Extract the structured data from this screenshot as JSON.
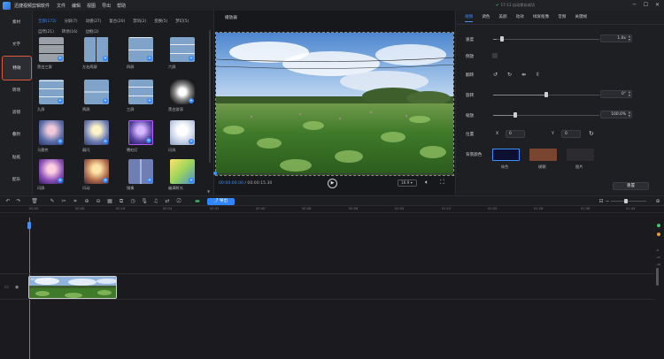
{
  "app": {
    "title": "迅捷视频剪辑软件"
  },
  "menu": [
    "文件",
    "编辑",
    "视图",
    "导出",
    "帮助"
  ],
  "save_status": "17:13 自动保存成功",
  "window_controls": [
    "minimize-icon",
    "maximize-icon",
    "close-icon"
  ],
  "left_rail": {
    "items": [
      {
        "label": "素材",
        "active": false
      },
      {
        "label": "文字",
        "active": false
      },
      {
        "label": "特效",
        "active": true
      },
      {
        "label": "转场",
        "active": false
      },
      {
        "label": "滤镜",
        "active": false
      },
      {
        "label": "叠附",
        "active": false
      },
      {
        "label": "贴纸",
        "active": false
      },
      {
        "label": "配乐",
        "active": false
      }
    ]
  },
  "effects": {
    "tabs": [
      {
        "label": "全部(172)",
        "active": true
      },
      {
        "label": "分屏(7)",
        "active": false
      },
      {
        "label": "动感(27)",
        "active": false
      },
      {
        "label": "复古(20)",
        "active": false
      },
      {
        "label": "禁风(2)",
        "active": false
      },
      {
        "label": "变换(5)",
        "active": false
      },
      {
        "label": "梦幻(5)",
        "active": false
      },
      {
        "label": "自然(21)",
        "active": false
      },
      {
        "label": "转场(16)",
        "active": false
      },
      {
        "label": "边框(2)",
        "active": false
      }
    ],
    "items": [
      {
        "label": "黑白三屏"
      },
      {
        "label": "左右两屏"
      },
      {
        "label": "四屏"
      },
      {
        "label": "六屏"
      },
      {
        "label": "九屏"
      },
      {
        "label": "两屏"
      },
      {
        "label": "三屏"
      },
      {
        "label": "黑白漩涡"
      },
      {
        "label": "马赛克"
      },
      {
        "label": "弱闪"
      },
      {
        "label": "霓虹灯"
      },
      {
        "label": "闪烁"
      },
      {
        "label": "闪屏"
      },
      {
        "label": "闪动"
      },
      {
        "label": "镜像"
      },
      {
        "label": "幽满射光"
      }
    ]
  },
  "player": {
    "title": "播放器",
    "current_time": "00:00:00.00",
    "total_time": "00:00:15.30",
    "aspect_ratio": "16:9",
    "progress": 0
  },
  "properties": {
    "tabs": [
      {
        "label": "视频",
        "active": true
      },
      {
        "label": "调色",
        "active": false
      },
      {
        "label": "美颜",
        "active": false
      },
      {
        "label": "动效",
        "active": false
      },
      {
        "label": "绿屏抠像",
        "active": false
      },
      {
        "label": "音频",
        "active": false
      },
      {
        "label": "关键帧",
        "active": false
      }
    ],
    "speed": {
      "label": "速度",
      "value": "1.0x",
      "level": 0.03
    },
    "reverse": {
      "label": "倒放"
    },
    "flip": {
      "label": "翻转"
    },
    "rotate": {
      "label": "旋转",
      "value": "0°",
      "level": 0.5
    },
    "scale": {
      "label": "缩放",
      "value": "100.0%",
      "level": 0.19
    },
    "position": {
      "label": "位置",
      "x_label": "X",
      "x": "0",
      "y_label": "Y",
      "y": "0"
    },
    "background": {
      "label": "背景颜色",
      "options": [
        {
          "label": "纯色",
          "color": "#0d1030"
        },
        {
          "label": "模糊",
          "color": "#7a4530"
        },
        {
          "label": "图片",
          "color": "#2c2c30"
        }
      ]
    },
    "reset_label": "重置"
  },
  "toolbar": {
    "export_label": "导出"
  },
  "timeline": {
    "ruler_ticks": [
      "00:00",
      "00:08",
      "00:16",
      "00:24",
      "00:32",
      "00:40",
      "00:48",
      "00:56",
      "01:04",
      "01:12",
      "01:20",
      "01:28",
      "01:36",
      "01:44"
    ],
    "clip_label": "00:00:15.30",
    "vu_labels": [
      "-6",
      "-12",
      "-18"
    ]
  },
  "colors": {
    "accent": "#2f86ff",
    "active_border": "#e0573a"
  }
}
